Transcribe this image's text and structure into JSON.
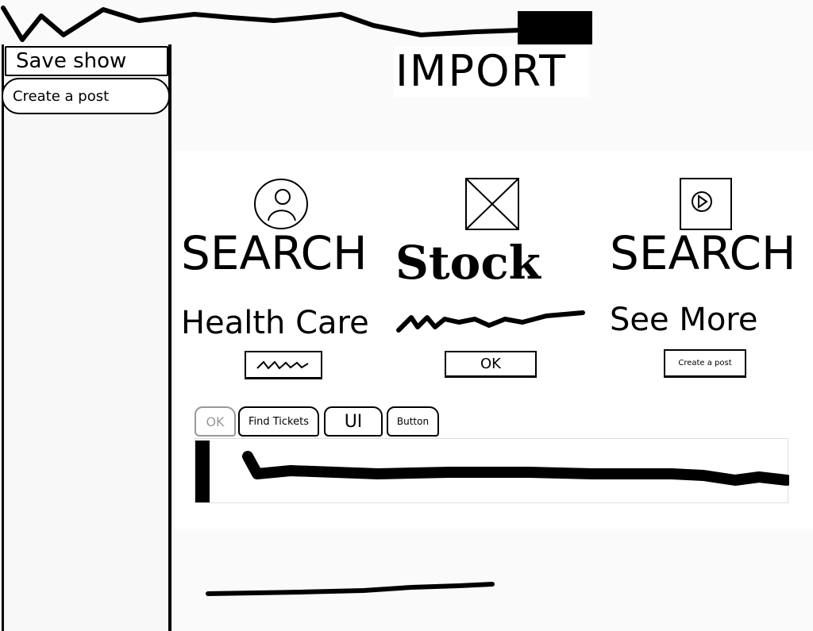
{
  "sidebar": {
    "items": [
      {
        "label": "Save show"
      },
      {
        "label": "Create a post"
      }
    ]
  },
  "header": {
    "title": "IMPORT"
  },
  "cards": [
    {
      "icon": "user-avatar-icon",
      "title": "SEARCH",
      "subtitle": "Health Care",
      "button_label": ""
    },
    {
      "icon": "image-placeholder-icon",
      "title": "Stock",
      "subtitle": "",
      "button_label": "OK"
    },
    {
      "icon": "play-icon",
      "title": "SEARCH",
      "subtitle": "See More",
      "button_label": "Create a post"
    }
  ],
  "tabs": [
    {
      "label": "OK",
      "selected": true
    },
    {
      "label": "Find Tickets",
      "selected": false
    },
    {
      "label": "UI",
      "selected": false
    },
    {
      "label": "Button",
      "selected": false
    }
  ]
}
